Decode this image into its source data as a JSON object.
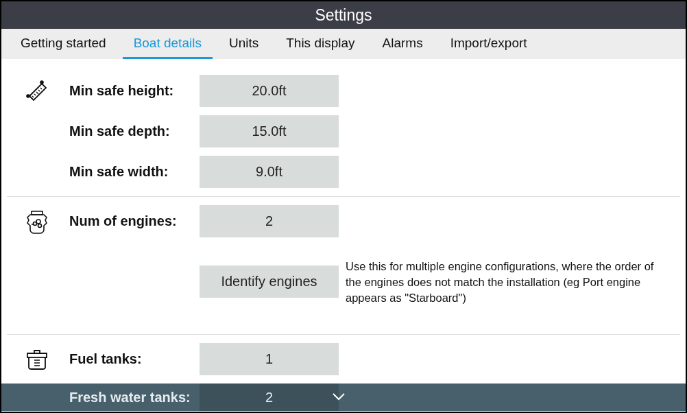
{
  "window": {
    "title": "Settings"
  },
  "tabs": [
    {
      "label": "Getting started",
      "selected": false
    },
    {
      "label": "Boat details",
      "selected": true
    },
    {
      "label": "Units",
      "selected": false
    },
    {
      "label": "This display",
      "selected": false
    },
    {
      "label": "Alarms",
      "selected": false
    },
    {
      "label": "Import/export",
      "selected": false
    }
  ],
  "sections": [
    {
      "kind": "dimensions",
      "rows": [
        {
          "kind": "field",
          "label": "Min safe height:",
          "value": "20.0ft"
        },
        {
          "kind": "field",
          "label": "Min safe depth:",
          "value": "15.0ft"
        },
        {
          "kind": "field",
          "label": "Min safe width:",
          "value": "9.0ft"
        }
      ]
    },
    {
      "kind": "engines",
      "rows": [
        {
          "kind": "field",
          "label": "Num of engines:",
          "value": "2"
        },
        {
          "kind": "action",
          "button": "Identify engines",
          "note": "Use this for multiple engine configurations, where the order of the engines does not match the installation (eg Port engine appears as \"Starboard\")"
        }
      ]
    },
    {
      "kind": "tanks",
      "rows": [
        {
          "kind": "field",
          "label": "Fuel tanks:",
          "value": "1"
        },
        {
          "kind": "field",
          "label": "Fresh water tanks:",
          "value": "2"
        }
      ]
    }
  ]
}
